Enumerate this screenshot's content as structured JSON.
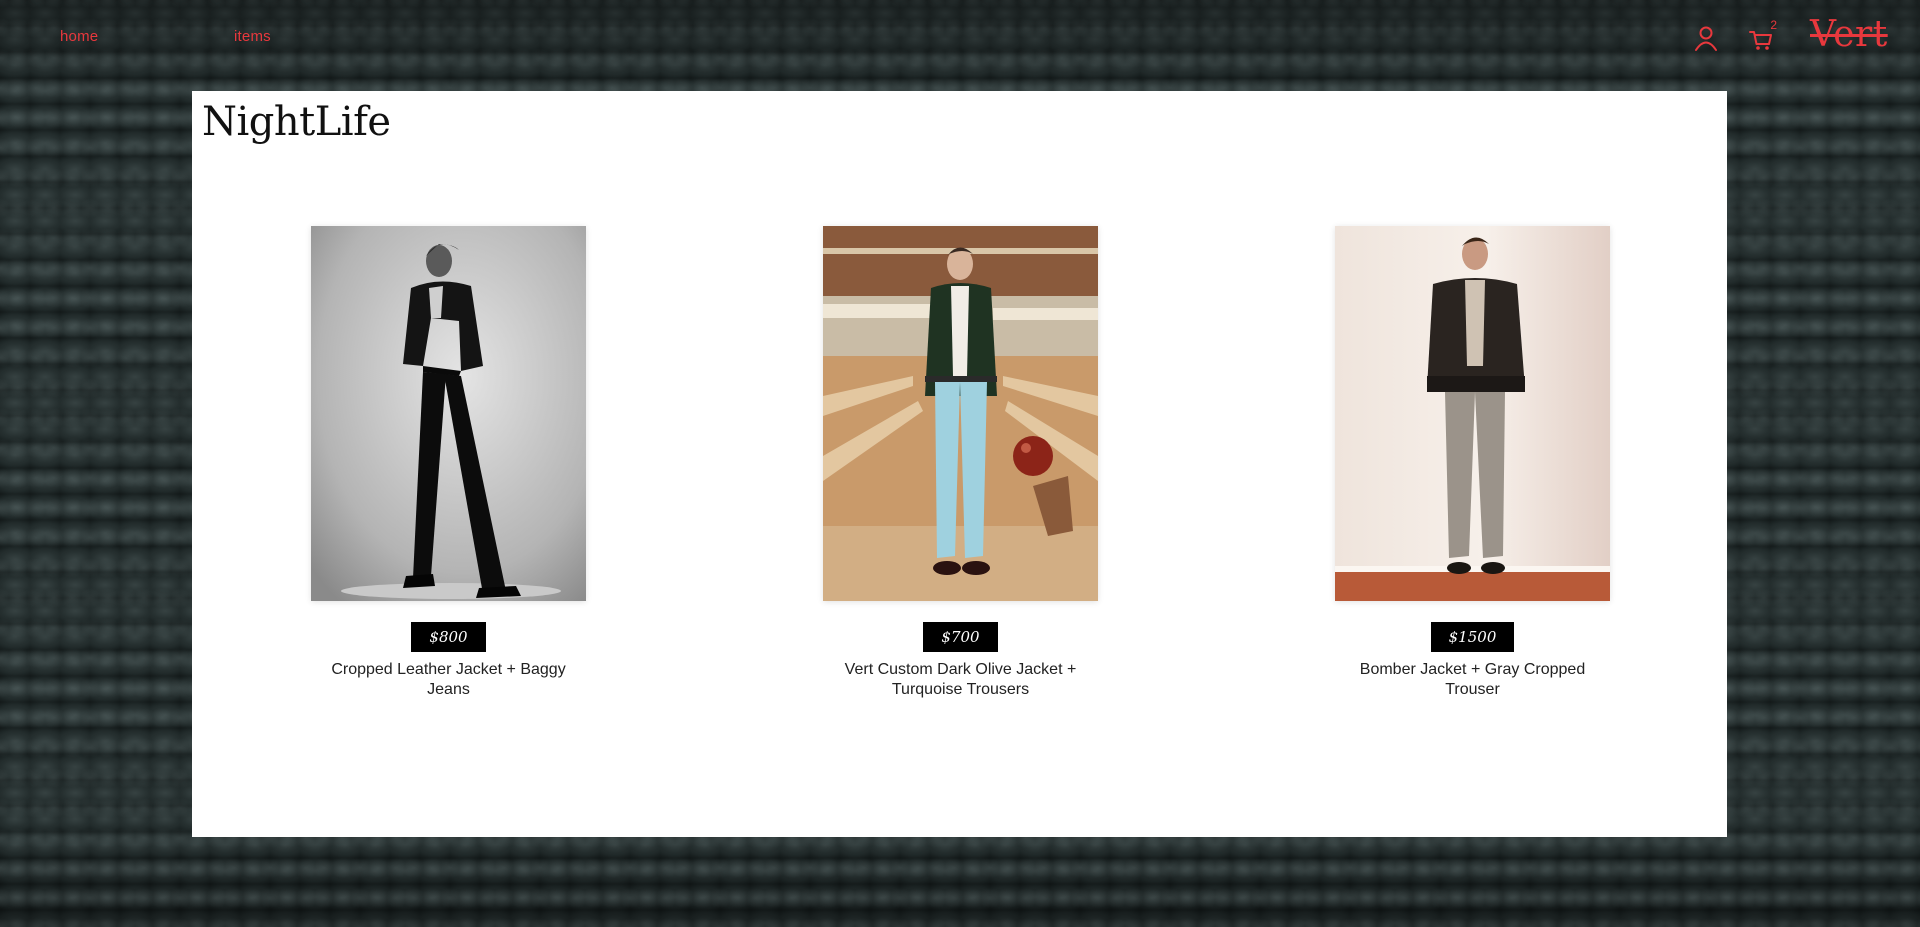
{
  "nav": {
    "home_label": "home",
    "items_label": "items",
    "cart_count": "2",
    "brand": "Vert",
    "accent_color": "#e8383d",
    "icons": [
      "user-icon",
      "cart-icon"
    ]
  },
  "page": {
    "title": "NightLife"
  },
  "products": [
    {
      "price": "$800",
      "name": "Cropped Leather Jacket + Baggy Jeans",
      "image": "photo of model in black cropped leather jacket and black flared trousers on gray background"
    },
    {
      "price": "$700",
      "name": "Vert Custom Dark Olive Jacket + Turquoise Trousers",
      "image": "photo of model in dark olive jacket and light turquoise trousers holding a bowling ball in a bowling alley"
    },
    {
      "price": "$1500",
      "name": "Bomber Jacket + Gray Cropped Trouser",
      "image": "photo of model in black bomber jacket and gray cropped trousers in a light room"
    }
  ]
}
